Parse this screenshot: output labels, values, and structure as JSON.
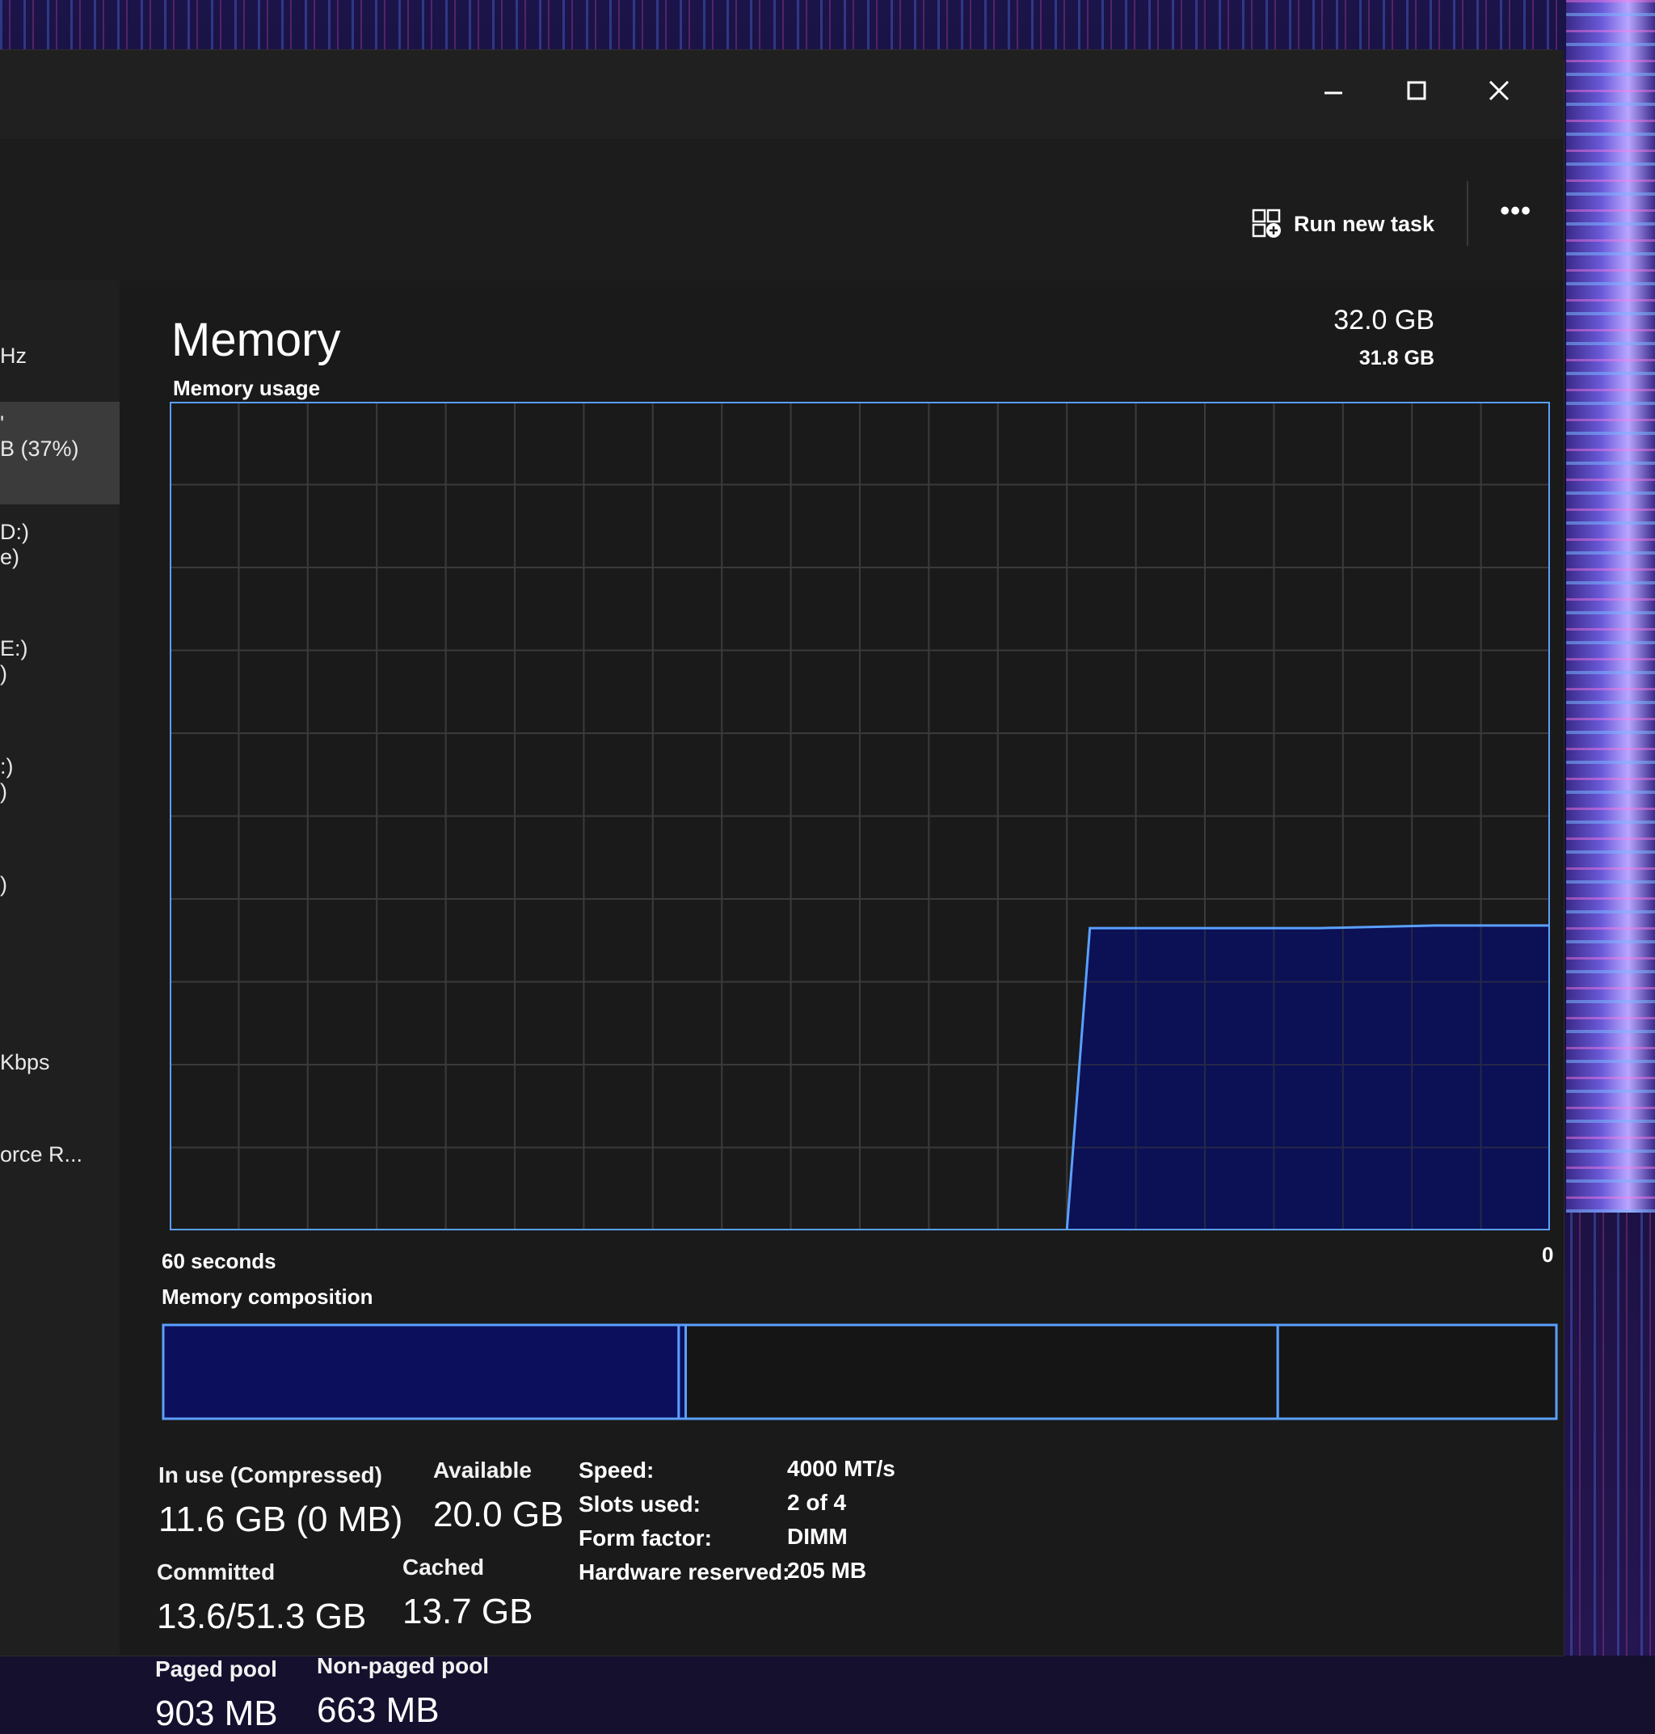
{
  "window": {
    "controls": {
      "minimize": "–",
      "maximize": "☐",
      "close": "✕"
    }
  },
  "commandbar": {
    "run_new_task": "Run new task",
    "run_new_task_icon": "run-task-icon",
    "more_label": "•••"
  },
  "sidebar": {
    "items": [
      {
        "line1": "Hz",
        "line2": ""
      },
      {
        "line1": "'",
        "line2": "B (37%)"
      },
      {
        "line1": "D:)",
        "line2": "e)"
      },
      {
        "line1": "E:)",
        "line2": ")"
      },
      {
        "line1": ":)",
        "line2": ")"
      },
      {
        "line1": ")",
        "line2": ""
      },
      {
        "line1": "Kbps",
        "line2": ""
      },
      {
        "line1": "orce R...",
        "line2": ""
      }
    ]
  },
  "header": {
    "title": "Memory",
    "total": "32.0 GB",
    "graph_max": "31.8 GB",
    "usage_label": "Memory usage",
    "x_left": "60 seconds",
    "x_right": "0",
    "composition_label": "Memory composition"
  },
  "colors": {
    "accent_line": "#5aa0ff",
    "accent_fill": "#0b0f5c",
    "grid": "#3a3a3a"
  },
  "chart_data": {
    "type": "area",
    "y_unit": "GB",
    "ylim": [
      0,
      31.8
    ],
    "x_unit": "seconds ago",
    "xlim": [
      60,
      0
    ],
    "grid": true,
    "series": [
      {
        "x": [
          60,
          21,
          20,
          15,
          10,
          5,
          0
        ],
        "values": [
          0,
          0,
          11.6,
          11.6,
          11.6,
          11.7,
          11.7
        ]
      }
    ]
  },
  "composition": {
    "in_use_fraction": 0.37,
    "modified_fraction": 0.005,
    "standby_fraction": 0.425,
    "free_fraction": 0.2
  },
  "stats": {
    "in_use_label": "In use (Compressed)",
    "in_use_value": "11.6 GB (0 MB)",
    "available_label": "Available",
    "available_value": "20.0 GB",
    "committed_label": "Committed",
    "committed_value": "13.6/51.3 GB",
    "cached_label": "Cached",
    "cached_value": "13.7 GB",
    "paged_pool_label": "Paged pool",
    "paged_pool_value": "903 MB",
    "nonpaged_pool_label": "Non-paged pool",
    "nonpaged_pool_value": "663 MB"
  },
  "specs": {
    "speed_key": "Speed:",
    "speed_val": "4000 MT/s",
    "slots_key": "Slots used:",
    "slots_val": "2 of 4",
    "form_key": "Form factor:",
    "form_val": "DIMM",
    "hw_key": "Hardware reserved:",
    "hw_val": "205 MB"
  }
}
